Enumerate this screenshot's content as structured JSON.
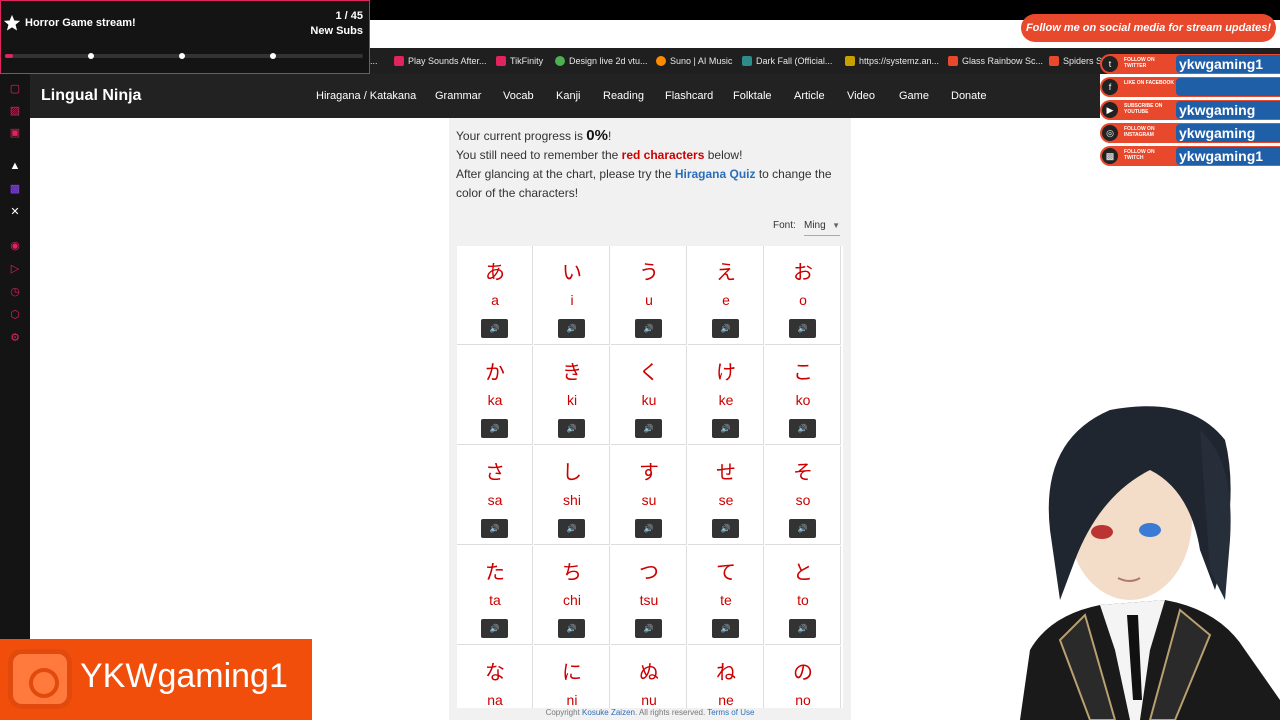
{
  "stream_overlay": {
    "title": "Horror Game stream!",
    "goal_count": "1 / 45",
    "goal_label": "New Subs",
    "progress": 0.022
  },
  "bookmarks": [
    {
      "label": "...",
      "color": "#1f1f1f"
    },
    {
      "label": "Play Sounds After...",
      "color": "#e0245e"
    },
    {
      "label": "TikFinity",
      "color": "#e0245e"
    },
    {
      "label": "Design live 2d vtu...",
      "color": "#4caf50"
    },
    {
      "label": "Suno | AI Music",
      "color": "#ff8c00"
    },
    {
      "label": "Dark Fall (Official...",
      "color": "#2e8b8b"
    },
    {
      "label": "https://systemz.an...",
      "color": "#c8a000"
    },
    {
      "label": "Glass Rainbow Sc...",
      "color": "#e8492c"
    },
    {
      "label": "Spiders S",
      "color": "#e8492c"
    }
  ],
  "navbar": {
    "brand": "Lingual Ninja",
    "items": [
      "Hiragana / Katakana",
      "Grammar",
      "Vocab",
      "Kanji",
      "Reading",
      "Flashcard",
      "Folktale",
      "Article",
      "Video",
      "Game",
      "Donate"
    ]
  },
  "progress": {
    "prefix": "Your current progress is",
    "value": "0%",
    "suffix": "!",
    "remember_prefix": "You still need to remember the",
    "remember_red": "red characters",
    "remember_suffix": "below!",
    "quiz_prefix": "After glancing at the chart, please try the",
    "quiz_link": "Hiragana Quiz",
    "quiz_suffix": "to change the",
    "quiz_line2": "color of the characters!"
  },
  "font_selector": {
    "label": "Font:",
    "value": "Ming"
  },
  "kana_rows": [
    [
      {
        "kana": "あ",
        "romaji": "a"
      },
      {
        "kana": "い",
        "romaji": "i"
      },
      {
        "kana": "う",
        "romaji": "u"
      },
      {
        "kana": "え",
        "romaji": "e"
      },
      {
        "kana": "お",
        "romaji": "o"
      }
    ],
    [
      {
        "kana": "か",
        "romaji": "ka"
      },
      {
        "kana": "き",
        "romaji": "ki"
      },
      {
        "kana": "く",
        "romaji": "ku"
      },
      {
        "kana": "け",
        "romaji": "ke"
      },
      {
        "kana": "こ",
        "romaji": "ko"
      }
    ],
    [
      {
        "kana": "さ",
        "romaji": "sa"
      },
      {
        "kana": "し",
        "romaji": "shi"
      },
      {
        "kana": "す",
        "romaji": "su"
      },
      {
        "kana": "せ",
        "romaji": "se"
      },
      {
        "kana": "そ",
        "romaji": "so"
      }
    ],
    [
      {
        "kana": "た",
        "romaji": "ta"
      },
      {
        "kana": "ち",
        "romaji": "chi"
      },
      {
        "kana": "つ",
        "romaji": "tsu"
      },
      {
        "kana": "て",
        "romaji": "te"
      },
      {
        "kana": "と",
        "romaji": "to"
      }
    ],
    [
      {
        "kana": "な",
        "romaji": "na"
      },
      {
        "kana": "に",
        "romaji": "ni"
      },
      {
        "kana": "ぬ",
        "romaji": "nu"
      },
      {
        "kana": "ね",
        "romaji": "ne"
      },
      {
        "kana": "の",
        "romaji": "no"
      }
    ]
  ],
  "copyright": {
    "prefix": "Copyright",
    "author": "Kosuke Zaizen",
    "middle": ". All rights reserved.",
    "terms": "Terms of Use"
  },
  "social": {
    "banner": "Follow me on social media for stream updates!",
    "accounts": [
      {
        "tag": "FOLLOW ON TWITTER",
        "handle": "ykwgaming1",
        "icon": "twitter-icon"
      },
      {
        "tag": "LIKE ON FACEBOOK",
        "handle": "",
        "icon": "facebook-icon"
      },
      {
        "tag": "SUBSCRIBE ON YOUTUBE",
        "handle": "ykwgaming",
        "icon": "youtube-icon"
      },
      {
        "tag": "FOLLOW ON INSTAGRAM",
        "handle": "ykwgaming",
        "icon": "instagram-icon"
      },
      {
        "tag": "FOLLOW ON TWITCH",
        "handle": "ykwgaming1",
        "icon": "twitch-icon"
      }
    ]
  },
  "brand_overlay": {
    "name": "YKWgaming1"
  },
  "colors": {
    "accent": "#e0245e",
    "kana_red": "#cc0000",
    "link_blue": "#2a6ebb",
    "overlay_orange": "#f04e0a"
  }
}
